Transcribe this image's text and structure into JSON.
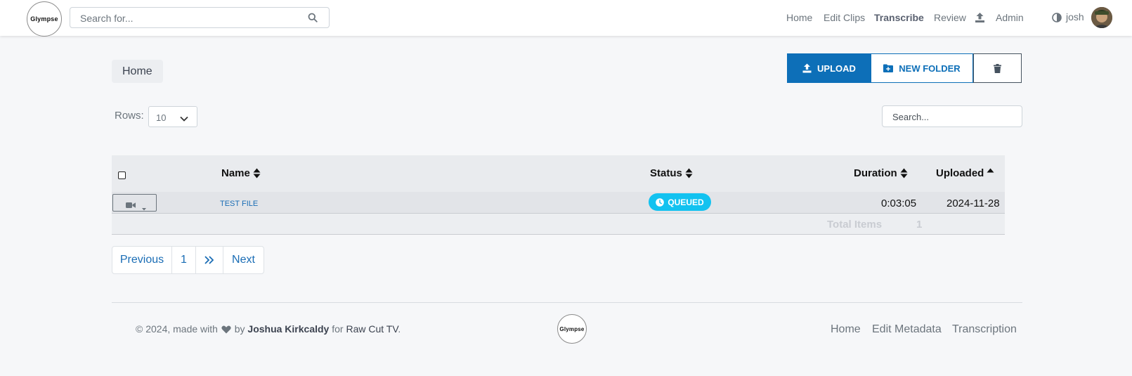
{
  "navbar": {
    "logo_text": "Glympse",
    "search_placeholder": "Search for...",
    "links": [
      {
        "label": "Home"
      },
      {
        "label": "Edit Clips"
      },
      {
        "label": "Transcribe"
      },
      {
        "label": "Review"
      },
      {
        "label": "Admin"
      }
    ],
    "username": "josh"
  },
  "breadcrumb": "Home",
  "toolbar": {
    "upload_label": "UPLOAD",
    "new_folder_label": "NEW FOLDER"
  },
  "rows": {
    "label": "Rows:",
    "value": "10"
  },
  "table_search_placeholder": "Search...",
  "table": {
    "columns": [
      "Name",
      "Status",
      "Duration",
      "Uploaded"
    ],
    "rows": [
      {
        "name": "TEST FILE",
        "status": "QUEUED",
        "duration": "0:03:05",
        "uploaded": "2024-11-28"
      }
    ],
    "total_label": "Total Items",
    "total_value": "1"
  },
  "pagination": {
    "previous": "Previous",
    "page": "1",
    "next": "Next"
  },
  "footer": {
    "copyright": "© 2024, made with",
    "by": "by",
    "author": "Joshua Kirkcaldy",
    "for": "for",
    "company": "Raw Cut TV",
    "period": ".",
    "logo_text": "Glympse",
    "links": [
      "Home",
      "Edit Metadata",
      "Transcription"
    ]
  },
  "colors": {
    "primary": "#0d6fb8",
    "badge": "#12c2f0",
    "background": "#f6f7f9"
  }
}
